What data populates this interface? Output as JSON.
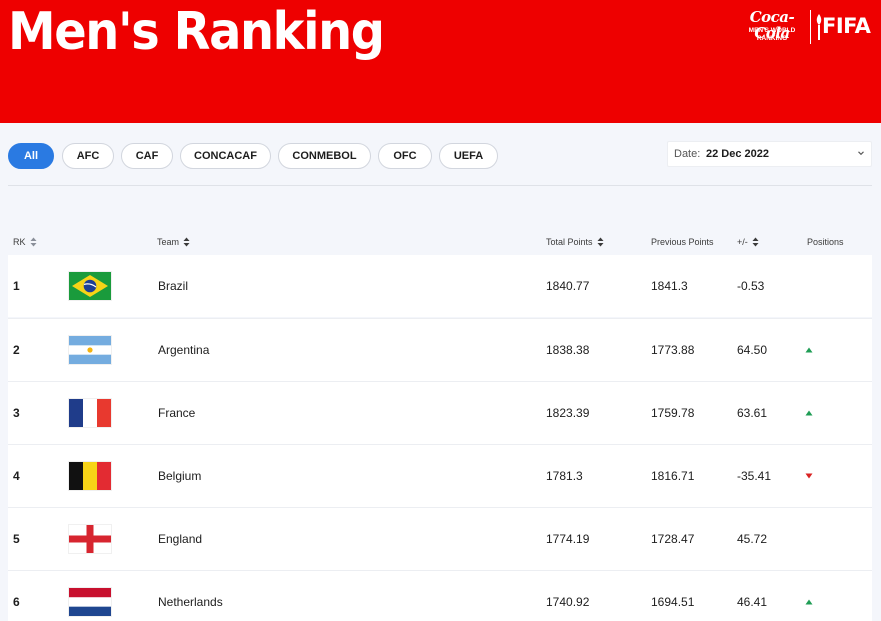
{
  "header": {
    "title": "Men's Ranking",
    "brand_cocacola": "Coca-Cola",
    "brand_subtitle": "MEN'S WORLD\nRANKING",
    "brand_fifa": "FIFA",
    "bg_color": "#ee0000"
  },
  "filters": {
    "items": [
      "All",
      "AFC",
      "CAF",
      "CONCACAF",
      "CONMEBOL",
      "OFC",
      "UEFA"
    ],
    "selected": "All",
    "accent_color": "#2a7ae2"
  },
  "date": {
    "label": "Date:",
    "value": "22 Dec 2022",
    "icon": "chevron-down-icon"
  },
  "table": {
    "columns": {
      "rk": "RK",
      "team": "Team",
      "total": "Total Points",
      "previous": "Previous Points",
      "diff": "+/-",
      "positions": "Positions"
    },
    "rows": [
      {
        "rank": "1",
        "team": "Brazil",
        "flag": "brazil-flag-icon",
        "total": "1840.77",
        "previous": "1841.3",
        "diff": "-0.53",
        "movement": "none"
      },
      {
        "rank": "2",
        "team": "Argentina",
        "flag": "argentina-flag-icon",
        "total": "1838.38",
        "previous": "1773.88",
        "diff": "64.50",
        "movement": "up"
      },
      {
        "rank": "3",
        "team": "France",
        "flag": "france-flag-icon",
        "total": "1823.39",
        "previous": "1759.78",
        "diff": "63.61",
        "movement": "up"
      },
      {
        "rank": "4",
        "team": "Belgium",
        "flag": "belgium-flag-icon",
        "total": "1781.3",
        "previous": "1816.71",
        "diff": "-35.41",
        "movement": "down"
      },
      {
        "rank": "5",
        "team": "England",
        "flag": "england-flag-icon",
        "total": "1774.19",
        "previous": "1728.47",
        "diff": "45.72",
        "movement": "none"
      },
      {
        "rank": "6",
        "team": "Netherlands",
        "flag": "netherlands-flag-icon",
        "total": "1740.92",
        "previous": "1694.51",
        "diff": "46.41",
        "movement": "up"
      }
    ],
    "up_color": "#1f9d55",
    "down_color": "#d92323"
  }
}
